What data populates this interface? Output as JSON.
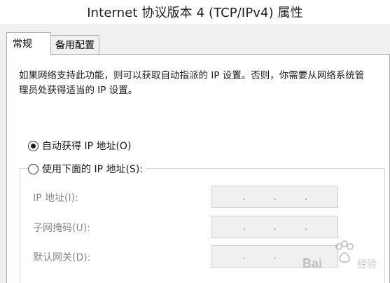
{
  "window": {
    "title": "Internet 协议版本 4 (TCP/IPv4) 属性"
  },
  "tabs": [
    {
      "label": "常规",
      "active": true
    },
    {
      "label": "备用配置",
      "active": false
    }
  ],
  "general": {
    "description": "如果网络支持此功能，则可以获取自动指派的 IP 设置。否则，你需要从网络系统管理员处获得适当的 IP 设置。",
    "radio_auto": {
      "label": "自动获得 IP 地址(O)",
      "checked": true
    },
    "radio_manual": {
      "label": "使用下面的 IP 地址(S):",
      "checked": false
    },
    "fields": [
      {
        "label": "IP 地址(I):",
        "value": "",
        "enabled": false
      },
      {
        "label": "子网掩码(U):",
        "value": "",
        "enabled": false
      },
      {
        "label": "默认网关(D):",
        "value": "",
        "enabled": false
      }
    ]
  },
  "watermark": {
    "text": "Baidu 经验"
  },
  "colors": {
    "dialog_bg": "#f0f0f0",
    "panel_bg": "#ffffff",
    "disabled_text": "#8a8a8a",
    "border": "#adadad"
  }
}
